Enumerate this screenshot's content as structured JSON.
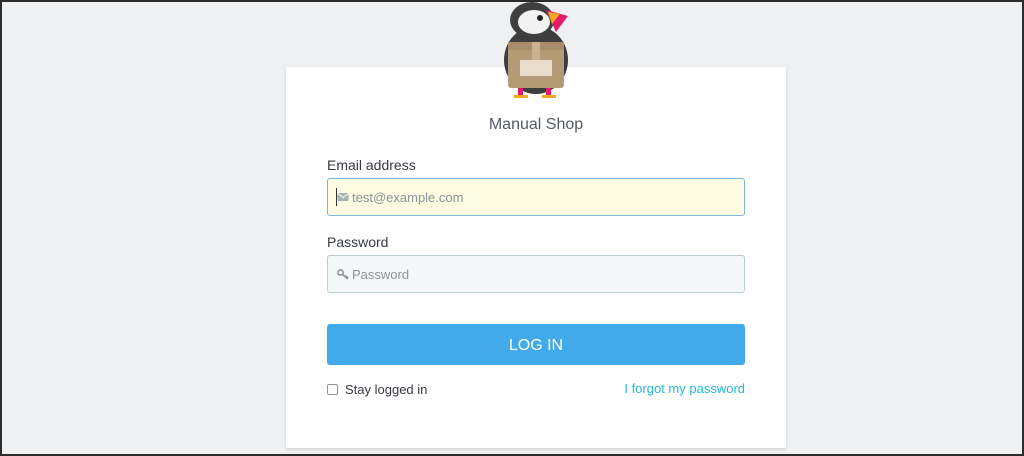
{
  "shop": {
    "name": "Manual Shop"
  },
  "form": {
    "email_label": "Email address",
    "email_placeholder": "test@example.com",
    "email_value": "",
    "password_label": "Password",
    "password_placeholder": "Password",
    "password_value": "",
    "login_label": "LOG IN",
    "stay_logged_in_label": "Stay logged in",
    "stay_logged_in_checked": false,
    "forgot_label": "I forgot my password"
  },
  "icons": {
    "mascot": "puffin-mascot-icon",
    "email": "envelope-icon",
    "password": "key-icon"
  },
  "colors": {
    "primary_button": "#42aaeb",
    "link": "#25b9d7",
    "email_field_bg": "#fdfbe2",
    "page_bg": "#eef0f2"
  }
}
